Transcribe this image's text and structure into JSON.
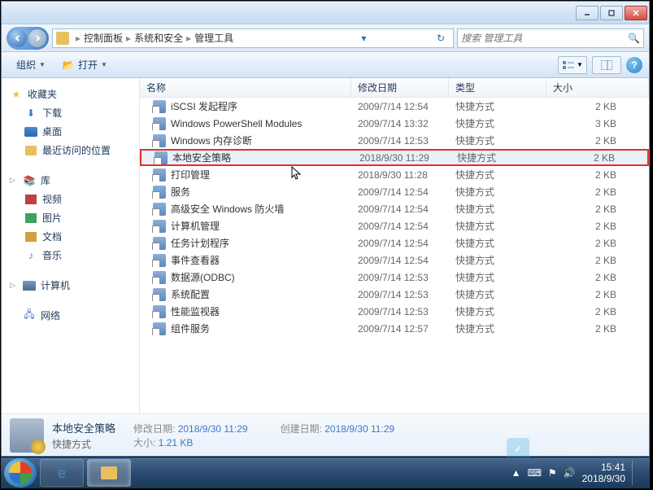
{
  "breadcrumb": {
    "items": [
      "控制面板",
      "系统和安全",
      "管理工具"
    ]
  },
  "search": {
    "placeholder": "搜索 管理工具"
  },
  "cmdbar": {
    "organize": "组织",
    "open": "打开"
  },
  "sidebar": {
    "favorites": {
      "label": "收藏夹",
      "items": [
        {
          "label": "下载",
          "icon": "download"
        },
        {
          "label": "桌面",
          "icon": "desktop"
        },
        {
          "label": "最近访问的位置",
          "icon": "recent"
        }
      ]
    },
    "libraries": {
      "label": "库",
      "items": [
        {
          "label": "视频",
          "icon": "video"
        },
        {
          "label": "图片",
          "icon": "picture"
        },
        {
          "label": "文档",
          "icon": "document"
        },
        {
          "label": "音乐",
          "icon": "music"
        }
      ]
    },
    "computer": {
      "label": "计算机"
    },
    "network": {
      "label": "网络"
    }
  },
  "columns": {
    "name": "名称",
    "date": "修改日期",
    "type": "类型",
    "size": "大小"
  },
  "files": [
    {
      "name": "iSCSI 发起程序",
      "date": "2009/7/14 12:54",
      "type": "快捷方式",
      "size": "2 KB"
    },
    {
      "name": "Windows PowerShell Modules",
      "date": "2009/7/14 13:32",
      "type": "快捷方式",
      "size": "3 KB"
    },
    {
      "name": "Windows 内存诊断",
      "date": "2009/7/14 12:53",
      "type": "快捷方式",
      "size": "2 KB"
    },
    {
      "name": "本地安全策略",
      "date": "2018/9/30 11:29",
      "type": "快捷方式",
      "size": "2 KB",
      "highlighted": true
    },
    {
      "name": "打印管理",
      "date": "2018/9/30 11:28",
      "type": "快捷方式",
      "size": "2 KB"
    },
    {
      "name": "服务",
      "date": "2009/7/14 12:54",
      "type": "快捷方式",
      "size": "2 KB"
    },
    {
      "name": "高级安全 Windows 防火墙",
      "date": "2009/7/14 12:54",
      "type": "快捷方式",
      "size": "2 KB"
    },
    {
      "name": "计算机管理",
      "date": "2009/7/14 12:54",
      "type": "快捷方式",
      "size": "2 KB"
    },
    {
      "name": "任务计划程序",
      "date": "2009/7/14 12:54",
      "type": "快捷方式",
      "size": "2 KB"
    },
    {
      "name": "事件查看器",
      "date": "2009/7/14 12:54",
      "type": "快捷方式",
      "size": "2 KB"
    },
    {
      "name": "数据源(ODBC)",
      "date": "2009/7/14 12:53",
      "type": "快捷方式",
      "size": "2 KB"
    },
    {
      "name": "系统配置",
      "date": "2009/7/14 12:53",
      "type": "快捷方式",
      "size": "2 KB"
    },
    {
      "name": "性能监视器",
      "date": "2009/7/14 12:53",
      "type": "快捷方式",
      "size": "2 KB"
    },
    {
      "name": "组件服务",
      "date": "2009/7/14 12:57",
      "type": "快捷方式",
      "size": "2 KB"
    }
  ],
  "details": {
    "title": "本地安全策略",
    "subtitle": "快捷方式",
    "props": {
      "modified_label": "修改日期:",
      "modified_value": "2018/9/30 11:29",
      "size_label": "大小:",
      "size_value": "1.21 KB",
      "created_label": "创建日期:",
      "created_value": "2018/9/30 11:29"
    }
  },
  "tray": {
    "time": "15:41",
    "date": "2018/9/30"
  },
  "watermark": "白云一键重装系统"
}
